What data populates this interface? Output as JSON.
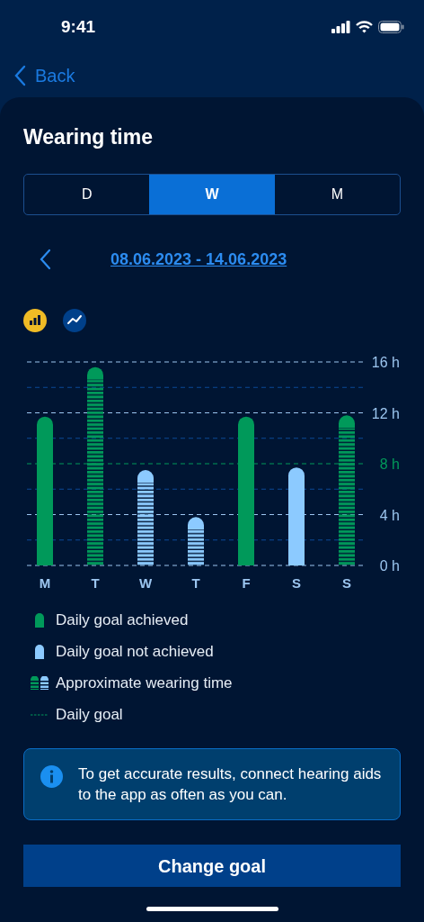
{
  "status_bar": {
    "time": "9:41"
  },
  "nav": {
    "back": "Back"
  },
  "title": "Wearing time",
  "tabs": [
    {
      "label": "D",
      "selected": false
    },
    {
      "label": "W",
      "selected": true
    },
    {
      "label": "M",
      "selected": false
    }
  ],
  "date_range": "08.06.2023 - 14.06.2023",
  "view_toggles": [
    {
      "kind": "bar",
      "selected": true
    },
    {
      "kind": "line",
      "selected": false
    }
  ],
  "chart": {
    "chart_data": {
      "type": "bar",
      "categories": [
        "M",
        "T",
        "W",
        "T",
        "F",
        "S",
        "S"
      ],
      "series": [
        {
          "values": [
            11.7,
            15.6,
            7.5,
            3.8,
            11.7,
            7.7,
            11.8
          ]
        }
      ],
      "ylim": [
        0,
        16
      ],
      "yticks": [
        {
          "value": 0,
          "label": "0 h"
        },
        {
          "value": 4,
          "label": "4 h"
        },
        {
          "value": 8,
          "label": "8 h"
        },
        {
          "value": 12,
          "label": "12 h"
        },
        {
          "value": 16,
          "label": "16 h"
        }
      ],
      "ref_lines": [
        {
          "axis": "y",
          "value": 2,
          "color": "#0b4a96"
        },
        {
          "axis": "y",
          "value": 6,
          "color": "#0b4a96"
        },
        {
          "axis": "y",
          "value": 8,
          "color": "#00995a"
        },
        {
          "axis": "y",
          "value": 10,
          "color": "#0b4a96"
        },
        {
          "axis": "y",
          "value": 14,
          "color": "#0b4a96"
        }
      ]
    },
    "bars": [
      {
        "achieved": true,
        "approximate": false
      },
      {
        "achieved": true,
        "approximate": true
      },
      {
        "achieved": false,
        "approximate": true
      },
      {
        "achieved": false,
        "approximate": true
      },
      {
        "achieved": true,
        "approximate": false
      },
      {
        "achieved": false,
        "approximate": false
      },
      {
        "achieved": true,
        "approximate": true
      }
    ]
  },
  "legend": [
    {
      "kind": "achieved",
      "label": "Daily goal achieved"
    },
    {
      "kind": "not_achieved",
      "label": "Daily goal not achieved"
    },
    {
      "kind": "approximate",
      "label": "Approximate wearing time"
    },
    {
      "kind": "goal",
      "label": "Daily goal"
    }
  ],
  "info": "To get accurate results, connect hearing aids to the app as often as you can.",
  "button": "Change goal"
}
